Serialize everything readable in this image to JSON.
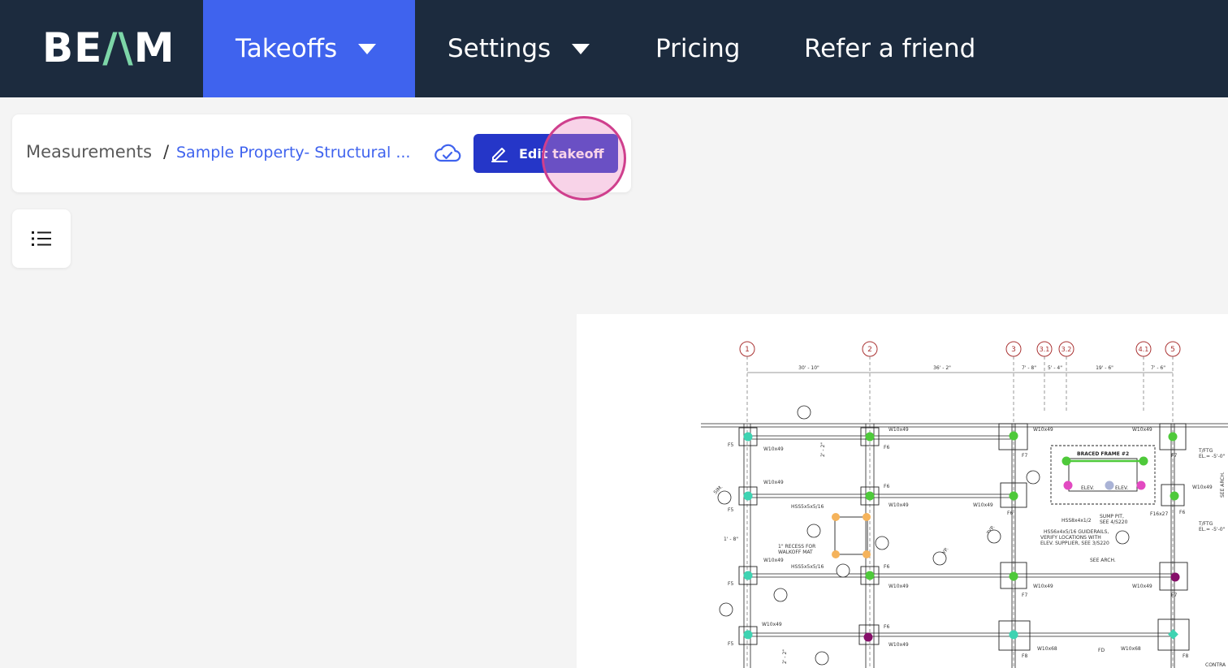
{
  "app": {
    "logo_left": "BE",
    "logo_accent": "/\\",
    "logo_right": "M"
  },
  "nav": {
    "takeoffs": "Takeoffs",
    "settings": "Settings",
    "pricing": "Pricing",
    "refer": "Refer a friend"
  },
  "toolbar": {
    "breadcrumb_root": "Measurements",
    "breadcrumb_sep": "/",
    "breadcrumb_current": "Sample Property- Structural ...",
    "edit_label": "Edit takeoff"
  },
  "colors": {
    "topbar": "#1c2b3e",
    "active_nav": "#3f63ee",
    "edit_button": "#2536c8",
    "marker_green": "#4ec93a",
    "marker_teal": "#3ed3b2",
    "marker_orange": "#f5b35b",
    "marker_magenta": "#e24ac1",
    "marker_purple": "#86106a",
    "marker_lavender": "#aab3d6"
  },
  "drawing": {
    "grid_labels": [
      "1",
      "2",
      "3",
      "3.1",
      "3.2",
      "4.1",
      "5"
    ],
    "dimensions": [
      "30' - 10\"",
      "36' - 2\"",
      "7' - 8\"",
      "5' - 4\"",
      "19' - 6\"",
      "7' - 6\""
    ],
    "annotations": {
      "braced_frame": "BRACED FRAME #2",
      "elev1": "ELEV.",
      "elev2": "ELEV.",
      "w10x49": "W10x49",
      "hss": "HSS5x5x5/16",
      "f5": "F5",
      "f6": "F6",
      "f7": "F7",
      "f8": "F8",
      "recess1": "1\" RECESS FOR",
      "recess2": "WALKOFF MAT",
      "sump1": "SUMP PIT,",
      "sump2": "SEE 4/S220",
      "guide1": "HSS6x4x5/16 GUIDERAILS,",
      "guide2": "VERIFY LOCATIONS WITH",
      "guide3": "ELEV. SUPPLIER, SEE 3/S220",
      "see_arch": "SEE ARCH.",
      "tftg1": "T/FTG",
      "tftg2": "EL.= -5'-0\"",
      "f16x27": "F16x27",
      "hss4": "HSS8x4x1/2",
      "w10x68": "W10x68",
      "fd": "FD",
      "contra": "CONTRA",
      "typ": "TYP.",
      "sim": "SIM.",
      "see_arch_v": "SEE ARCH.",
      "dim_22": "2' - 2\"",
      "dim_18": "1' - 8\""
    }
  }
}
